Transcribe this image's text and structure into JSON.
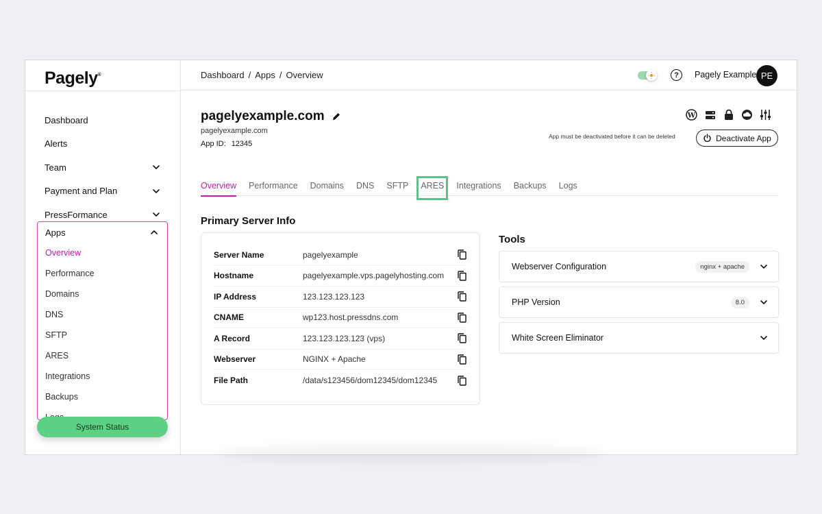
{
  "brand": {
    "logo": "Pagely",
    "mark": "®"
  },
  "breadcrumb": [
    "Dashboard",
    "/",
    "Apps",
    "/",
    "Overview"
  ],
  "user": {
    "name": "Pagely Example",
    "initials": "PE"
  },
  "sidebar": {
    "items": [
      {
        "label": "Dashboard",
        "expandable": false
      },
      {
        "label": "Alerts",
        "expandable": false
      },
      {
        "label": "Team",
        "expandable": true
      },
      {
        "label": "Payment and Plan",
        "expandable": true
      },
      {
        "label": "PressFormance",
        "expandable": true
      }
    ],
    "apps": {
      "label": "Apps",
      "subitems": [
        "Overview",
        "Performance",
        "Domains",
        "DNS",
        "SFTP",
        "ARES",
        "Integrations",
        "Backups",
        "Logs"
      ],
      "active": "Overview"
    },
    "system_status": "System Status"
  },
  "app": {
    "title": "pagelyexample.com",
    "domain": "pagelyexample.com",
    "id_label": "App ID:",
    "id_value": "12345",
    "deactivate_note": "App must be deactivated before it can be deleted",
    "deactivate_label": "Deactivate App"
  },
  "tool_icons": [
    "wordpress-icon",
    "server-icon",
    "lock-icon",
    "cloud-icon",
    "sliders-icon"
  ],
  "tabs": [
    {
      "label": "Overview",
      "active": true
    },
    {
      "label": "Performance"
    },
    {
      "label": "Domains"
    },
    {
      "label": "DNS"
    },
    {
      "label": "SFTP"
    },
    {
      "label": "ARES",
      "highlighted": true
    },
    {
      "label": "Integrations"
    },
    {
      "label": "Backups"
    },
    {
      "label": "Logs"
    }
  ],
  "server_info": {
    "title": "Primary Server Info",
    "rows": [
      {
        "label": "Server Name",
        "value": "pagelyexample"
      },
      {
        "label": "Hostname",
        "value": "pagelyexample.vps.pagelyhosting.com"
      },
      {
        "label": "IP Address",
        "value": "123.123.123.123"
      },
      {
        "label": "CNAME",
        "value": "wp123.host.pressdns.com"
      },
      {
        "label": "A Record",
        "value": "123.123.123.123 (vps)"
      },
      {
        "label": "Webserver",
        "value": "NGINX + Apache"
      },
      {
        "label": "File Path",
        "value": "/data/s123456/dom12345/dom12345"
      }
    ]
  },
  "tools": {
    "title": "Tools",
    "items": [
      {
        "label": "Webserver Configuration",
        "badge": "nginx + apache"
      },
      {
        "label": "PHP Version",
        "badge": "8.0"
      },
      {
        "label": "White Screen Eliminator",
        "badge": ""
      }
    ]
  },
  "colors": {
    "accent": "#c41aa6",
    "highlight": "#5cc28a",
    "status": "#5dd183"
  }
}
